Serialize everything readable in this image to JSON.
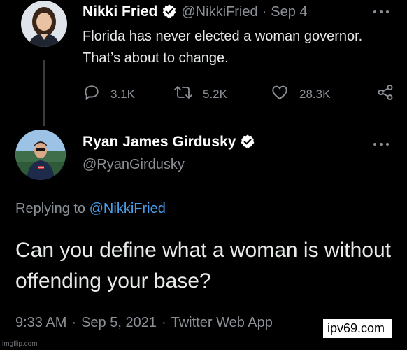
{
  "tweet1": {
    "name": "Nikki Fried",
    "handle": "@NikkiFried",
    "date": "Sep 4",
    "separator": "·",
    "text": "Florida has never elected a woman governor. That’s about to change.",
    "avatar_icon": "profile-photo-woman",
    "more_icon": "ellipsis-icon",
    "actions": {
      "reply": {
        "icon": "reply-bubble-icon",
        "count": "3.1K"
      },
      "retweet": {
        "icon": "retweet-icon",
        "count": "5.2K"
      },
      "like": {
        "icon": "heart-icon",
        "count": "28.3K"
      },
      "share": {
        "icon": "share-icon"
      }
    }
  },
  "tweet2": {
    "name": "Ryan James Girdusky",
    "handle": "@RyanGirdusky",
    "avatar_icon": "profile-photo-man",
    "more_icon": "ellipsis-icon",
    "replying_prefix": "Replying to",
    "replying_to": "@NikkiFried",
    "text": "Can you define what a woman is without offending your base?",
    "time": "9:33 AM",
    "date": "Sep 5, 2021",
    "source": "Twitter Web App",
    "separator": "·"
  },
  "watermark": "ipv69.com",
  "imgflip": "imgflip.com",
  "colors": {
    "background": "#000000",
    "text": "#e7e9ea",
    "muted": "#8b9096",
    "link": "#4a9ee8",
    "verified_badge": "#ffffff"
  }
}
